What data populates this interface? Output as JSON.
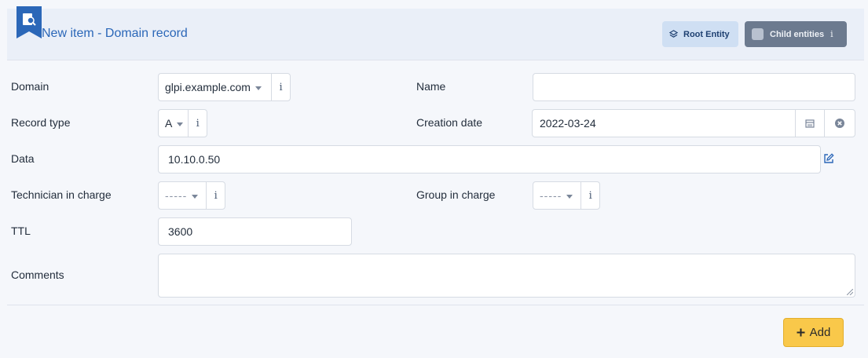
{
  "header": {
    "title": "New item - Domain record",
    "root_entity_label": "Root Entity",
    "child_entities_label": "Child entities",
    "child_entities_info": "i"
  },
  "form": {
    "domain": {
      "label": "Domain",
      "value": "glpi.example.com",
      "info": "i"
    },
    "name": {
      "label": "Name",
      "value": ""
    },
    "record_type": {
      "label": "Record type",
      "value": "A",
      "info": "i"
    },
    "creation_date": {
      "label": "Creation date",
      "value": "2022-03-24"
    },
    "data": {
      "label": "Data",
      "value": "10.10.0.50"
    },
    "technician": {
      "label": "Technician in charge",
      "value": "-----",
      "info": "i"
    },
    "group": {
      "label": "Group in charge",
      "value": "-----",
      "info": "i"
    },
    "ttl": {
      "label": "TTL",
      "value": "3600"
    },
    "comments": {
      "label": "Comments",
      "value": ""
    }
  },
  "actions": {
    "add_label": "Add"
  },
  "colors": {
    "accent": "#2b67b8",
    "add_button": "#f9c84a",
    "header_bg": "#eaeff8"
  },
  "icons": [
    "domain-record-icon",
    "layers-icon",
    "calendar-icon",
    "clear-icon",
    "edit-icon",
    "plus-icon",
    "info-icon",
    "chevron-down-icon"
  ]
}
